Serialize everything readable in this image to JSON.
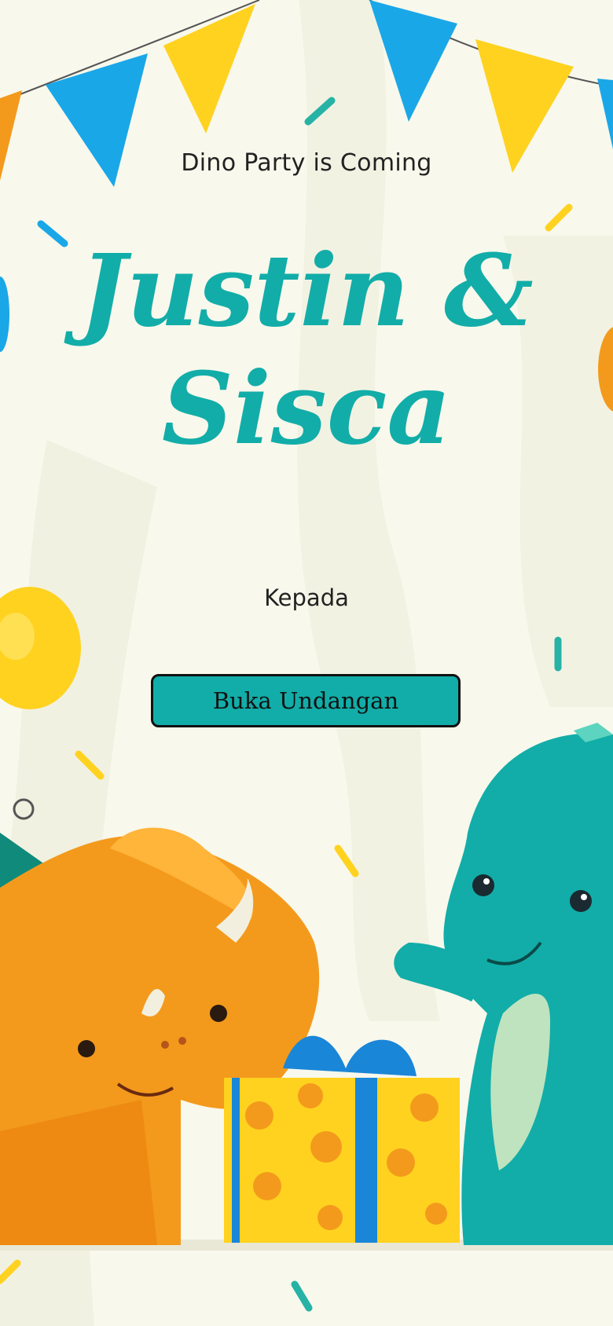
{
  "invitation": {
    "subtitle": "Dino Party is Coming",
    "names_line1": "Justin &",
    "names_line2": "Sisca",
    "to_label": "Kepada",
    "open_button_label": "Buka Undangan"
  },
  "colors": {
    "accent": "#12ada8",
    "background": "#f8f8ec",
    "text": "#222222"
  }
}
